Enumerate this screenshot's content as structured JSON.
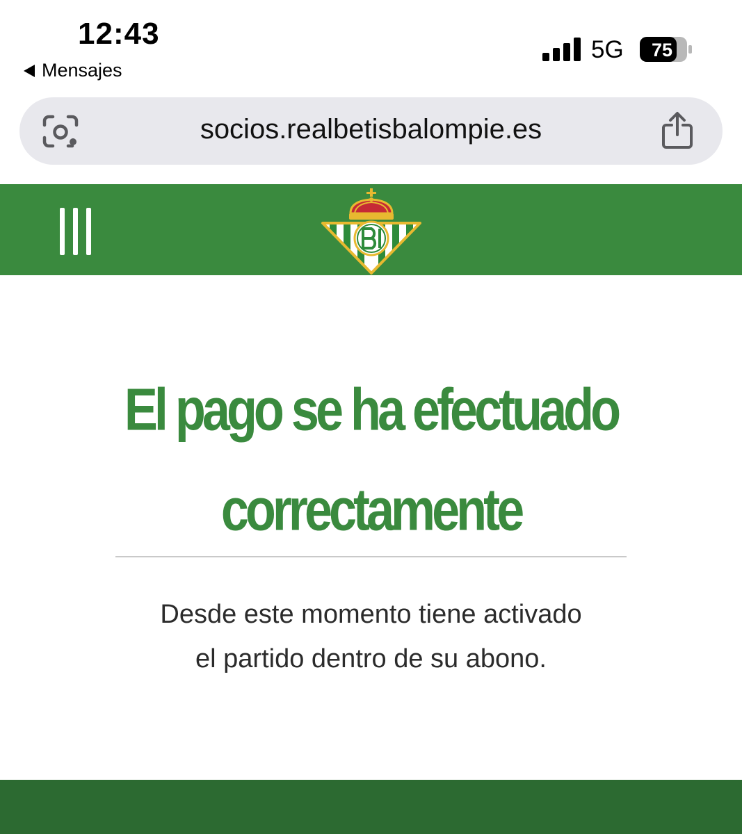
{
  "status_bar": {
    "time": "12:43",
    "back_label": "Mensajes",
    "network": "5G",
    "battery_level": "75"
  },
  "browser": {
    "url": "socios.realbetisbalompie.es"
  },
  "site": {
    "brand_color": "#3a8a3e",
    "footer_color": "#2c6a31",
    "menu_icon": "menu-icon",
    "logo": "real-betis-crest"
  },
  "content": {
    "headline_line1": "El pago se ha efectuado",
    "headline_line2": "correctamente",
    "message_line1": "Desde este momento tiene activado",
    "message_line2": "el partido dentro de su abono."
  }
}
